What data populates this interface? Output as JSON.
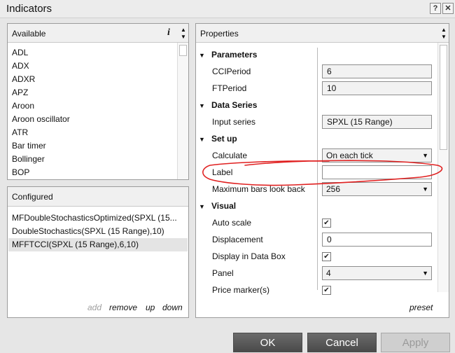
{
  "window": {
    "title": "Indicators",
    "help_glyph": "?",
    "close_glyph": "✕"
  },
  "available": {
    "header": "Available",
    "info_glyph": "i",
    "items": [
      "ADL",
      "ADX",
      "ADXR",
      "APZ",
      "Aroon",
      "Aroon oscillator",
      "ATR",
      "Bar timer",
      "Bollinger",
      "BOP"
    ]
  },
  "configured": {
    "header": "Configured",
    "items": [
      "MFDoubleStochasticsOptimized(SPXL (15...",
      "DoubleStochastics(SPXL (15 Range),10)",
      "MFFTCCI(SPXL (15 Range),6,10)"
    ],
    "actions": {
      "add": "add",
      "remove": "remove",
      "up": "up",
      "down": "down"
    }
  },
  "properties": {
    "header": "Properties",
    "parameters": {
      "label": "Parameters",
      "cci_label": "CCIPeriod",
      "cci_value": "6",
      "ft_label": "FTPeriod",
      "ft_value": "10"
    },
    "data_series": {
      "label": "Data Series",
      "input_label": "Input series",
      "input_value": "SPXL (15 Range)"
    },
    "setup": {
      "label": "Set up",
      "calculate_label": "Calculate",
      "calculate_value": "On each tick",
      "label_label": "Label",
      "label_value": "",
      "max_bars_label": "Maximum bars look back",
      "max_bars_value": "256"
    },
    "visual": {
      "label": "Visual",
      "auto_scale_label": "Auto scale",
      "auto_scale": true,
      "displacement_label": "Displacement",
      "displacement_value": "0",
      "databox_label": "Display in Data Box",
      "databox": true,
      "panel_label": "Panel",
      "panel_value": "4",
      "price_marker_label": "Price marker(s)",
      "price_marker": true
    },
    "preset": "preset"
  },
  "buttons": {
    "ok": "OK",
    "cancel": "Cancel",
    "apply": "Apply"
  },
  "colors": {
    "annotation": "#e02020",
    "accent_dark": "#555555"
  }
}
